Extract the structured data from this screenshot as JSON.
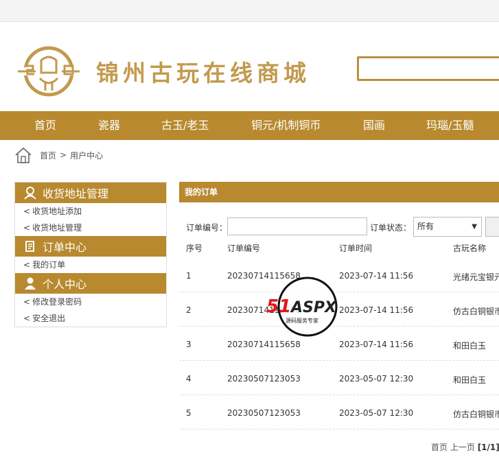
{
  "site": {
    "title": "锦州古玩在线商城"
  },
  "search": {
    "placeholder": ""
  },
  "nav": {
    "items": [
      "首页",
      "瓷器",
      "古玉/老玉",
      "铜元/机制铜币",
      "国画",
      "玛瑙/玉髓"
    ]
  },
  "breadcrumb": {
    "home": "首页",
    "separator": ">",
    "current": "用户中心"
  },
  "sidebar": {
    "sections": [
      {
        "title": "收货地址管理",
        "icon": "person-address-icon",
        "links": [
          "收货地址添加",
          "收货地址管理"
        ]
      },
      {
        "title": "订单中心",
        "icon": "order-scroll-icon",
        "links": [
          "我的订单"
        ]
      },
      {
        "title": "个人中心",
        "icon": "user-icon",
        "links": [
          "修改登录密码",
          "安全退出"
        ]
      }
    ],
    "link_prefix": "<"
  },
  "orders": {
    "title": "我的订单",
    "filter": {
      "order_no_label": "订单编号：",
      "status_label": "订单状态：",
      "status_value": "所有"
    },
    "columns": [
      "序号",
      "订单编号",
      "订单时间",
      "古玩名称"
    ],
    "rows": [
      {
        "no": "1",
        "order_no": "20230714115658",
        "time": "2023-07-14 11:56",
        "name": "光绪元宝银元"
      },
      {
        "no": "2",
        "order_no": "20230714115658",
        "time": "2023-07-14 11:56",
        "name": "仿古白铜银币"
      },
      {
        "no": "3",
        "order_no": "20230714115658",
        "time": "2023-07-14 11:56",
        "name": "和田白玉"
      },
      {
        "no": "4",
        "order_no": "20230507123053",
        "time": "2023-05-07 12:30",
        "name": "和田白玉"
      },
      {
        "no": "5",
        "order_no": "20230507123053",
        "time": "2023-05-07 12:30",
        "name": "仿古白铜银币"
      }
    ]
  },
  "pager": {
    "first": "首页",
    "prev": "上一页",
    "current": "[1/1]"
  },
  "watermark": {
    "brand_a": "51",
    "brand_b": "ASPX",
    "tagline": "源码服务专家"
  },
  "colors": {
    "brand": "#b8892e",
    "title": "#c29a4e"
  }
}
